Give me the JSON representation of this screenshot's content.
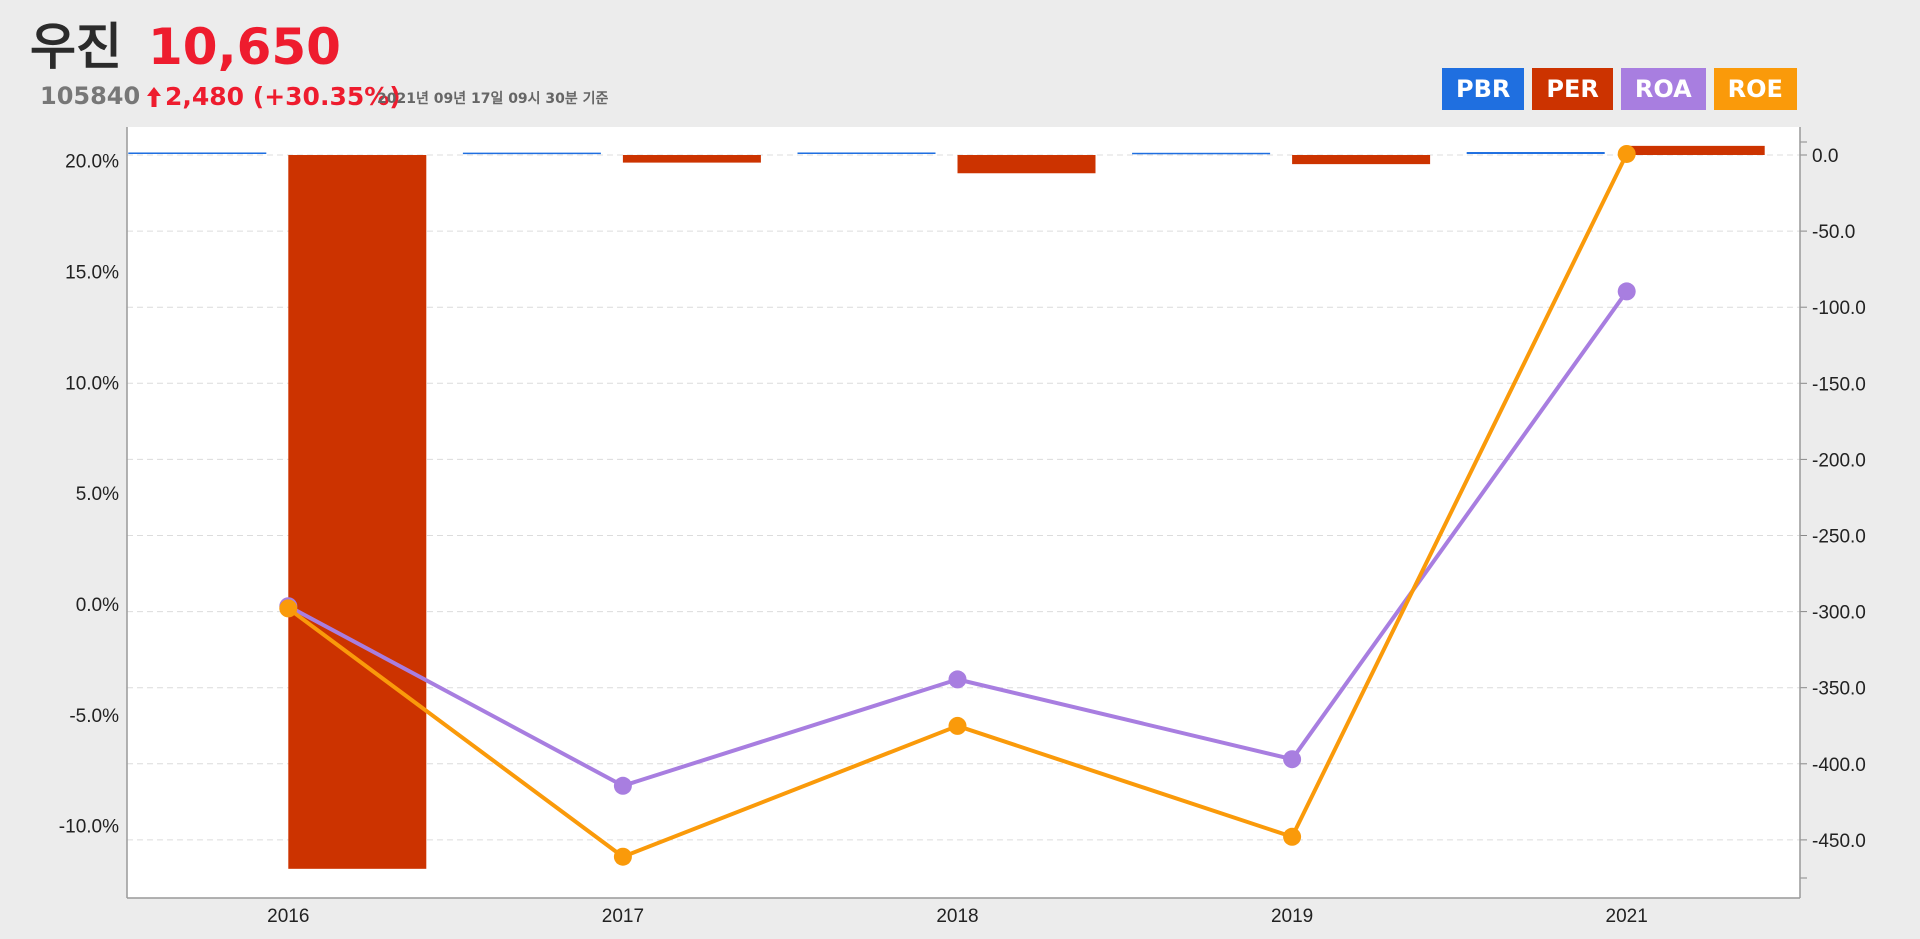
{
  "header": {
    "name": "우진",
    "price": "10,650",
    "code": "105840",
    "change": "2,480 (+30.35%)",
    "date": "2021년 09년 17일 09시 30분 기준"
  },
  "colors": {
    "PBR": "#1f6fe0",
    "PER": "#cc3300",
    "ROA": "#a87ee0",
    "ROE": "#fa9a0a",
    "price_up": "#ee1c2e"
  },
  "chart_data": {
    "type": "bar",
    "categories": [
      "2016",
      "2017",
      "2018",
      "2019",
      "2021"
    ],
    "series": [
      {
        "name": "PBR",
        "type": "bar",
        "axis": "right",
        "values": [
          1.0,
          0.9,
          1.0,
          0.8,
          1.3
        ]
      },
      {
        "name": "PER",
        "type": "bar",
        "axis": "right",
        "values": [
          -469,
          -5,
          -12,
          -6,
          6
        ]
      },
      {
        "name": "ROA",
        "type": "line",
        "axis": "left",
        "values": [
          -0.1,
          -8.2,
          -3.4,
          -7.0,
          14.1
        ]
      },
      {
        "name": "ROE",
        "type": "line",
        "axis": "left",
        "values": [
          -0.2,
          -11.4,
          -5.5,
          -10.5,
          20.3
        ]
      }
    ],
    "y_left": {
      "ticks": [
        20,
        15,
        10,
        5,
        0,
        -5,
        -10
      ],
      "tick_labels": [
        "20.0%",
        "15.0%",
        "10.0%",
        "5.0%",
        "0.0%",
        "-5.0%",
        "-10.0%"
      ]
    },
    "y_right": {
      "ticks": [
        0,
        -50,
        -100,
        -150,
        -200,
        -250,
        -300,
        -350,
        -400,
        -450
      ],
      "tick_labels": [
        "0.0",
        "-50.0",
        "-100.0",
        "-150.0",
        "-200.0",
        "-250.0",
        "-300.0",
        "-350.0",
        "-400.0",
        "-450.0"
      ]
    },
    "legend": [
      "PBR",
      "PER",
      "ROA",
      "ROE"
    ],
    "legend_position": "top-right",
    "grid": true
  }
}
